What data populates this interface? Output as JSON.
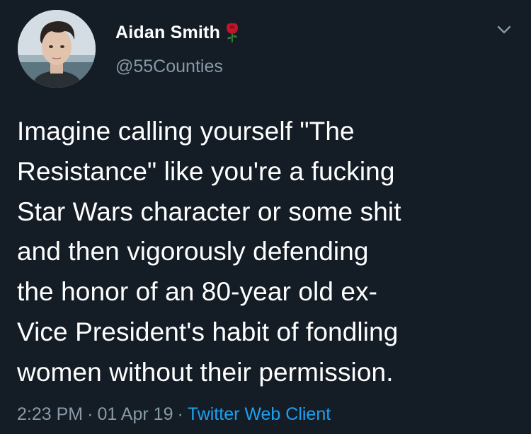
{
  "author": {
    "display_name": "Aidan Smith",
    "handle": "@55Counties",
    "badge_icon": "rose-icon",
    "avatar_icon": "avatar-photo"
  },
  "tweet": {
    "text": "Imagine calling yourself \"The\nResistance\" like you're a fucking\nStar Wars character or some shit\nand then vigorously defending\nthe honor of an 80-year old ex-\nVice President's habit of fondling\nwomen without their permission."
  },
  "meta": {
    "time": "2:23 PM",
    "separator": "·",
    "date": "01 Apr 19",
    "client": "Twitter Web Client"
  },
  "menu": {
    "icon": "chevron-down-icon"
  },
  "colors": {
    "background": "#141d26",
    "text_primary": "#ffffff",
    "text_secondary": "#8899a6",
    "link": "#1da1f2",
    "rose": "#c0152a"
  }
}
